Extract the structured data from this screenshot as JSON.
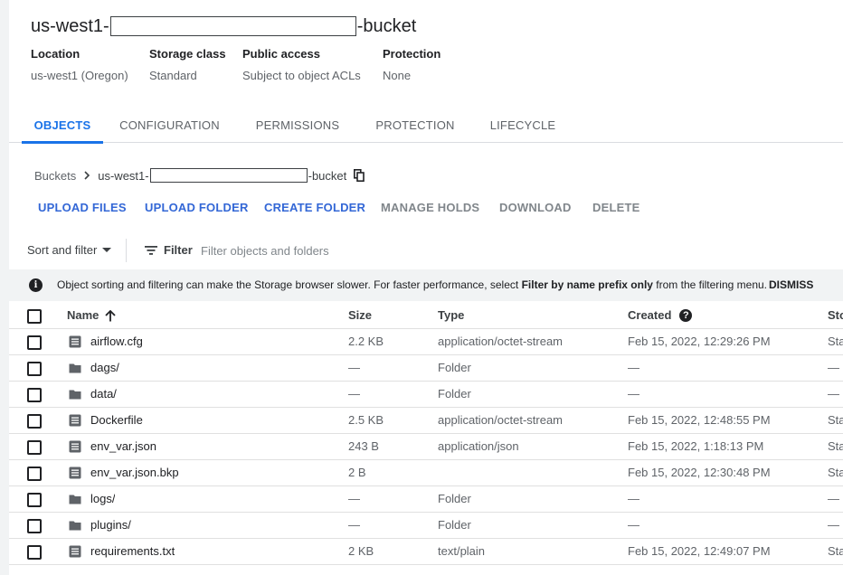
{
  "bucket": {
    "title_prefix": "us-west1-",
    "title_suffix": "-bucket"
  },
  "properties": [
    {
      "label": "Location",
      "value": "us-west1 (Oregon)"
    },
    {
      "label": "Storage class",
      "value": "Standard"
    },
    {
      "label": "Public access",
      "value": "Subject to object ACLs"
    },
    {
      "label": "Protection",
      "value": "None"
    }
  ],
  "tabs": [
    {
      "label": "OBJECTS",
      "active": true
    },
    {
      "label": "CONFIGURATION",
      "active": false
    },
    {
      "label": "PERMISSIONS",
      "active": false
    },
    {
      "label": "PROTECTION",
      "active": false
    },
    {
      "label": "LIFECYCLE",
      "active": false
    }
  ],
  "breadcrumb": {
    "root": "Buckets",
    "current_prefix": "us-west1-",
    "current_suffix": "-bucket"
  },
  "actions": [
    {
      "label": "UPLOAD FILES",
      "enabled": true
    },
    {
      "label": "UPLOAD FOLDER",
      "enabled": true
    },
    {
      "label": "CREATE FOLDER",
      "enabled": true
    },
    {
      "label": "MANAGE HOLDS",
      "enabled": false
    },
    {
      "label": "DOWNLOAD",
      "enabled": false
    },
    {
      "label": "DELETE",
      "enabled": false
    }
  ],
  "filter_bar": {
    "sort_label": "Sort and filter",
    "filter_label": "Filter",
    "placeholder": "Filter objects and folders"
  },
  "banner": {
    "text_before": "Object sorting and filtering can make the Storage browser slower. For faster performance, select ",
    "bold": "Filter by name prefix only",
    "text_after": " from the filtering menu.",
    "dismiss": "DISMISS"
  },
  "table": {
    "columns": {
      "name": "Name",
      "size": "Size",
      "type": "Type",
      "created": "Created",
      "storage": "Sto"
    },
    "rows": [
      {
        "name": "airflow.cfg",
        "kind": "file",
        "size": "2.2 KB",
        "type": "application/octet-stream",
        "created": "Feb 15, 2022, 12:29:26 PM",
        "storage": "Sta"
      },
      {
        "name": "dags/",
        "kind": "folder",
        "size": "—",
        "type": "Folder",
        "created": "—",
        "storage": "—"
      },
      {
        "name": "data/",
        "kind": "folder",
        "size": "—",
        "type": "Folder",
        "created": "—",
        "storage": "—"
      },
      {
        "name": "Dockerfile",
        "kind": "file",
        "size": "2.5 KB",
        "type": "application/octet-stream",
        "created": "Feb 15, 2022, 12:48:55 PM",
        "storage": "Sta"
      },
      {
        "name": "env_var.json",
        "kind": "file",
        "size": "243 B",
        "type": "application/json",
        "created": "Feb 15, 2022, 1:18:13 PM",
        "storage": "Sta"
      },
      {
        "name": "env_var.json.bkp",
        "kind": "file",
        "size": "2 B",
        "type": "",
        "created": "Feb 15, 2022, 12:30:48 PM",
        "storage": "Sta"
      },
      {
        "name": "logs/",
        "kind": "folder",
        "size": "—",
        "type": "Folder",
        "created": "—",
        "storage": "—"
      },
      {
        "name": "plugins/",
        "kind": "folder",
        "size": "—",
        "type": "Folder",
        "created": "—",
        "storage": "—"
      },
      {
        "name": "requirements.txt",
        "kind": "file",
        "size": "2 KB",
        "type": "text/plain",
        "created": "Feb 15, 2022, 12:49:07 PM",
        "storage": "Sta"
      }
    ]
  }
}
